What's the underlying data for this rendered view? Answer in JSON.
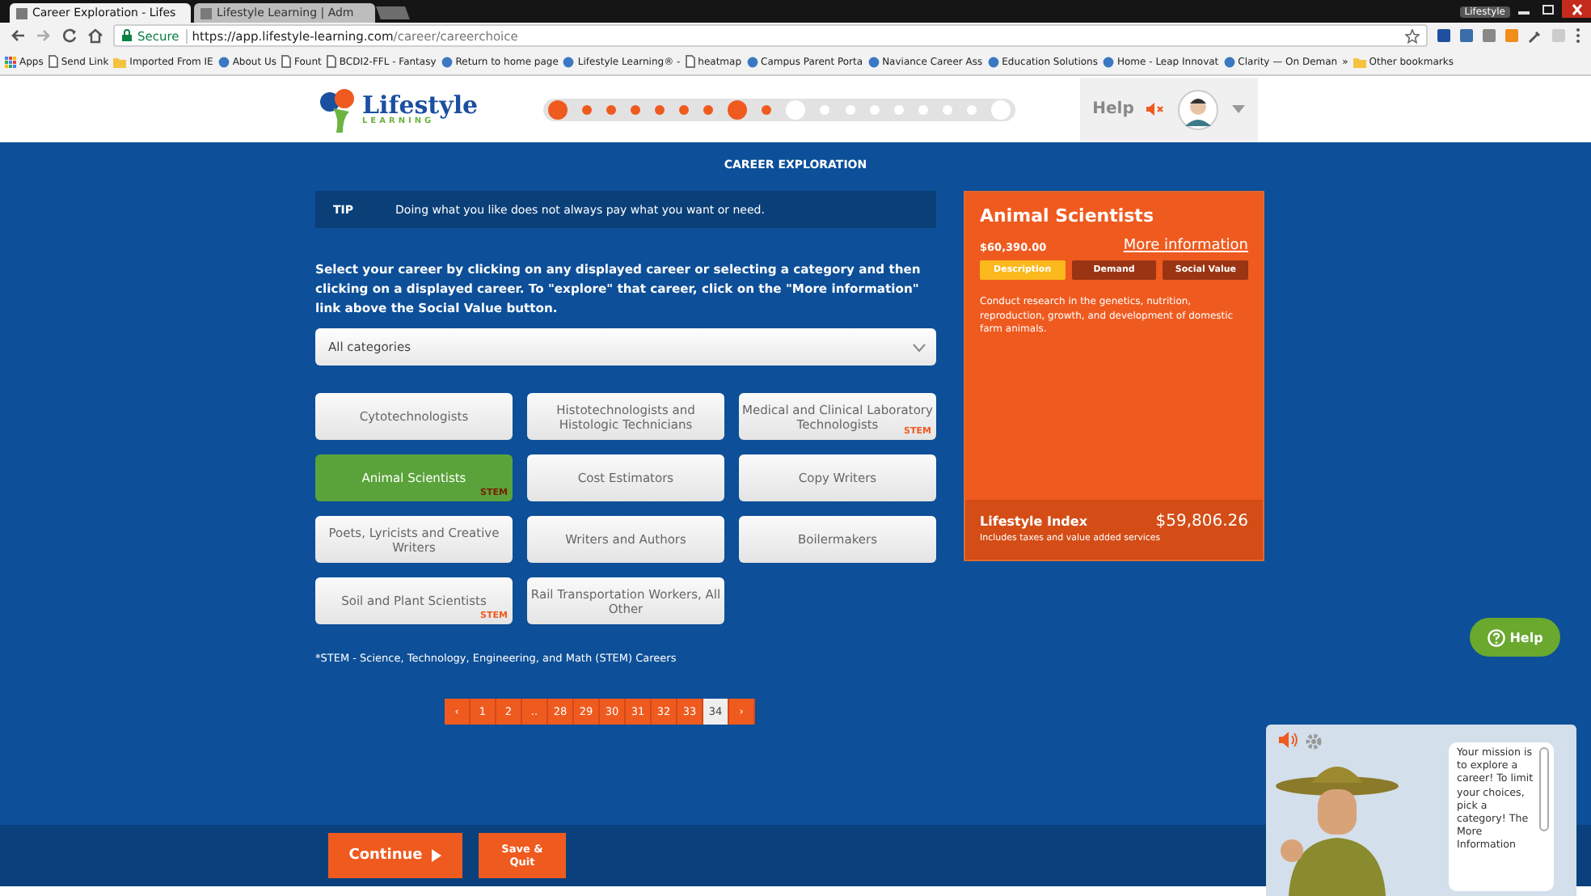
{
  "browser": {
    "tabs": [
      {
        "label": "Career Exploration - Lifes",
        "selected": true
      },
      {
        "label": "Lifestyle Learning | Adm",
        "selected": false
      }
    ],
    "profile": "Lifestyle",
    "address": {
      "secure": "Secure",
      "host": "https://app.lifestyle-learning.com",
      "path": "/career/careerchoice"
    },
    "bookmarks": [
      {
        "label": "Apps",
        "kind": "apps"
      },
      {
        "label": "Send Link",
        "kind": "page"
      },
      {
        "label": "Imported From IE",
        "kind": "folder"
      },
      {
        "label": "About Us",
        "kind": "site"
      },
      {
        "label": "Fount",
        "kind": "page"
      },
      {
        "label": "BCDI2-FFL - Fantasy",
        "kind": "page"
      },
      {
        "label": "Return to home page",
        "kind": "site"
      },
      {
        "label": "Lifestyle Learning® -",
        "kind": "site"
      },
      {
        "label": "heatmap",
        "kind": "page"
      },
      {
        "label": "Campus Parent Porta",
        "kind": "site"
      },
      {
        "label": "Naviance Career Ass",
        "kind": "site"
      },
      {
        "label": "Education Solutions",
        "kind": "site"
      },
      {
        "label": "Home - Leap Innovat",
        "kind": "site"
      },
      {
        "label": "Clarity — On Deman",
        "kind": "site"
      }
    ],
    "more": "»",
    "other": "Other bookmarks"
  },
  "header": {
    "logo": "Lifestyle",
    "logo_sub": "LEARNING",
    "help": "Help",
    "progress": [
      {
        "kind": "big",
        "reached": true
      },
      {
        "kind": "small",
        "reached": true
      },
      {
        "kind": "small",
        "reached": true
      },
      {
        "kind": "small",
        "reached": true
      },
      {
        "kind": "small",
        "reached": true
      },
      {
        "kind": "small",
        "reached": true
      },
      {
        "kind": "small",
        "reached": true
      },
      {
        "kind": "big",
        "reached": true
      },
      {
        "kind": "small",
        "reached": true
      },
      {
        "kind": "big",
        "reached": false
      },
      {
        "kind": "small",
        "reached": false
      },
      {
        "kind": "small",
        "reached": false
      },
      {
        "kind": "small",
        "reached": false
      },
      {
        "kind": "small",
        "reached": false
      },
      {
        "kind": "small",
        "reached": false
      },
      {
        "kind": "small",
        "reached": false
      },
      {
        "kind": "small",
        "reached": false
      },
      {
        "kind": "big",
        "reached": false
      }
    ]
  },
  "page_title": "CAREER EXPLORATION",
  "tip": {
    "label": "TIP",
    "text": "Doing what you like does not always pay what you want or need."
  },
  "instructions": "Select your career by clicking on any displayed career or selecting a category and then clicking on a displayed career. To \"explore\" that career, click on the \"More information\" link above the Social Value button.",
  "category": {
    "value": "All categories"
  },
  "careers": [
    [
      {
        "label": "Cytotechnologists",
        "selected": false
      },
      {
        "label": "Animal Scientists",
        "tag": "STEM",
        "selected": true
      },
      {
        "label": "Poets, Lyricists and Creative Writers",
        "selected": false
      },
      {
        "label": "Soil and Plant Scientists",
        "tag": "STEM",
        "selected": false
      }
    ],
    [
      {
        "label": "Histotechnologists and Histologic Technicians",
        "selected": false
      },
      {
        "label": "Cost Estimators",
        "selected": false
      },
      {
        "label": "Writers and Authors",
        "selected": false
      },
      {
        "label": "Rail Transportation Workers, All Other",
        "selected": false
      }
    ],
    [
      {
        "label": "Medical and Clinical Laboratory Technologists",
        "tag": "STEM",
        "selected": false
      },
      {
        "label": "Copy Writers",
        "selected": false
      },
      {
        "label": "Boilermakers",
        "selected": false
      }
    ]
  ],
  "stem_note": "*STEM - Science, Technology, Engineering, and Math (STEM) Careers",
  "pagination": [
    {
      "label": "‹",
      "selected": false
    },
    {
      "label": "1",
      "selected": false
    },
    {
      "label": "2",
      "selected": false
    },
    {
      "label": "..",
      "selected": false
    },
    {
      "label": "28",
      "selected": false
    },
    {
      "label": "29",
      "selected": false
    },
    {
      "label": "30",
      "selected": false
    },
    {
      "label": "31",
      "selected": false
    },
    {
      "label": "32",
      "selected": false
    },
    {
      "label": "33",
      "selected": false
    },
    {
      "label": "34",
      "selected": true
    },
    {
      "label": "›",
      "selected": false
    }
  ],
  "card": {
    "title": "Animal Scientists",
    "salary": "$60,390.00",
    "more": "More information",
    "tabs": [
      {
        "label": "Description",
        "selected": true
      },
      {
        "label": "Demand",
        "selected": false
      },
      {
        "label": "Social Value",
        "selected": false
      }
    ],
    "description": "Conduct research in the genetics, nutrition, reproduction, growth, and development of domestic farm animals.",
    "index_label": "Lifestyle Index",
    "index_value": "$59,806.26",
    "index_note": "Includes taxes and value added services"
  },
  "help_button": "Help",
  "footer": {
    "continue": "Continue",
    "save": "Save & Quit"
  },
  "mascot": {
    "message": "Your mission is to explore a career! To limit your choices, pick a category! The More Information"
  }
}
